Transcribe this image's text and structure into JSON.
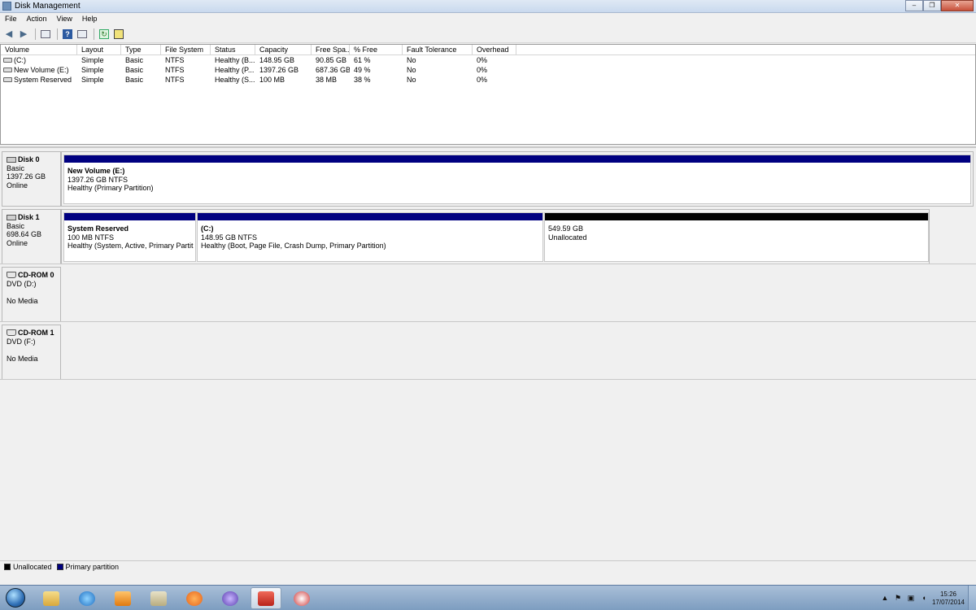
{
  "window": {
    "title": "Disk Management",
    "controls": {
      "minimize": "–",
      "maximize": "❐",
      "close": "✕"
    }
  },
  "menu": [
    "File",
    "Action",
    "View",
    "Help"
  ],
  "toolbar": {
    "buttons": [
      "back-icon",
      "forward-icon",
      "show-hide-console-tree-icon",
      "help-icon",
      "properties-icon",
      "refresh-icon",
      "export-list-icon"
    ],
    "help_glyph": "?",
    "refresh_glyph": "↻"
  },
  "volumes": {
    "headers": [
      "Volume",
      "Layout",
      "Type",
      "File System",
      "Status",
      "Capacity",
      "Free Spa...",
      "% Free",
      "Fault Tolerance",
      "Overhead"
    ],
    "rows": [
      [
        "(C:)",
        "Simple",
        "Basic",
        "NTFS",
        "Healthy (B...",
        "148.95 GB",
        "90.85 GB",
        "61 %",
        "No",
        "0%"
      ],
      [
        "New Volume (E:)",
        "Simple",
        "Basic",
        "NTFS",
        "Healthy (P...",
        "1397.26 GB",
        "687.36 GB",
        "49 %",
        "No",
        "0%"
      ],
      [
        "System Reserved",
        "Simple",
        "Basic",
        "NTFS",
        "Healthy (S...",
        "100 MB",
        "38 MB",
        "38 %",
        "No",
        "0%"
      ]
    ]
  },
  "disks": [
    {
      "name": "Disk 0",
      "type": "Basic",
      "size": "1397.26 GB",
      "status": "Online",
      "partitions": [
        {
          "name": "New Volume  (E:)",
          "size": "1397.26 GB NTFS",
          "status": "Healthy (Primary Partition)",
          "kind": "primary"
        }
      ]
    },
    {
      "name": "Disk 1",
      "type": "Basic",
      "size": "698.64 GB",
      "status": "Online",
      "partitions": [
        {
          "name": "System Reserved",
          "size": "100 MB NTFS",
          "status": "Healthy (System, Active, Primary Partition)",
          "kind": "primary"
        },
        {
          "name": "(C:)",
          "size": "148.95 GB NTFS",
          "status": "Healthy (Boot, Page File, Crash Dump, Primary Partition)",
          "kind": "primary"
        },
        {
          "name": "",
          "size": "549.59 GB",
          "status": "Unallocated",
          "kind": "unallocated"
        }
      ]
    }
  ],
  "cdroms": [
    {
      "name": "CD-ROM 0",
      "drive": "DVD (D:)",
      "media": "No Media"
    },
    {
      "name": "CD-ROM 1",
      "drive": "DVD (F:)",
      "media": "No Media"
    }
  ],
  "legend": [
    {
      "label": "Unallocated",
      "color": "#000000"
    },
    {
      "label": "Primary partition",
      "color": "#000080"
    }
  ],
  "colors": {
    "primary": "#000080",
    "unallocated": "#000000"
  },
  "taskbar": {
    "apps": [
      "windows-explorer-icon",
      "internet-explorer-icon",
      "media-player-icon",
      "folder-icon",
      "avast-icon",
      "bittorrent-icon",
      "toolbox-icon",
      "snipping-tool-icon"
    ],
    "tray": [
      "show-hidden-icons-icon",
      "action-center-flag-icon",
      "network-icon",
      "volume-icon"
    ],
    "time": "15:26",
    "date": "17/07/2014"
  }
}
